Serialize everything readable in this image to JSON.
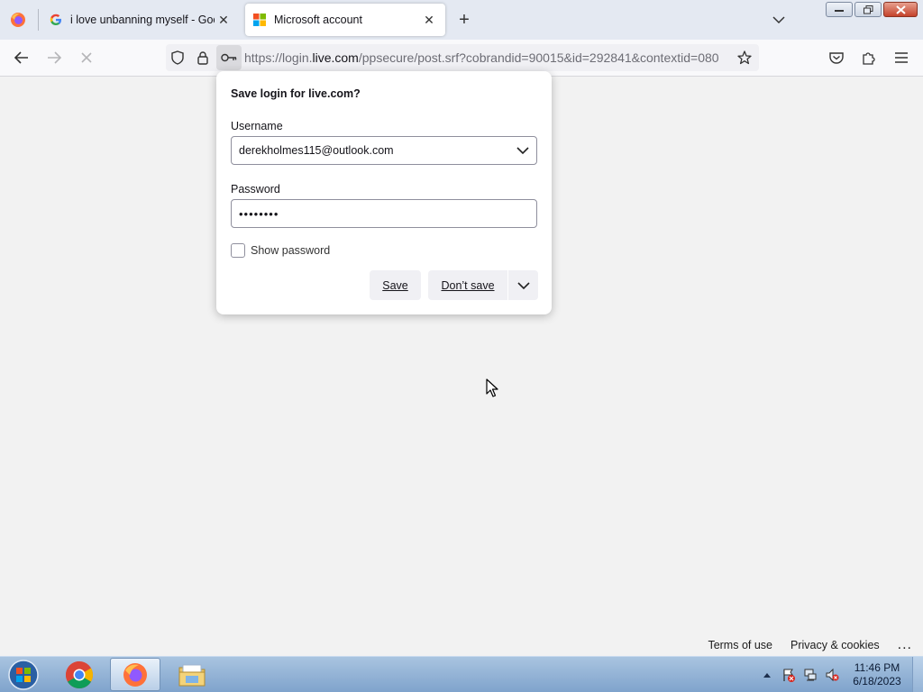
{
  "browser": {
    "tabs": [
      {
        "title": "i love unbanning myself - Goog",
        "favicon": "google-icon",
        "active": false
      },
      {
        "title": "Microsoft account",
        "favicon": "microsoft-icon",
        "active": true
      }
    ],
    "url": {
      "prefix": "https://login.",
      "host": "live.com",
      "path": "/ppsecure/post.srf?cobrandid=90015&id=292841&contextid=080"
    }
  },
  "doorhanger": {
    "title": "Save login for live.com?",
    "username_label": "Username",
    "username_value": "derekholmes115@outlook.com",
    "password_label": "Password",
    "password_value": "••••••••",
    "show_password_label": "Show password",
    "save_label": "Save",
    "dont_save_label": "Don’t save"
  },
  "footer": {
    "terms": "Terms of use",
    "privacy": "Privacy & cookies",
    "more": "..."
  },
  "taskbar": {
    "apps": [
      "chrome-icon",
      "firefox-icon",
      "file-explorer-icon"
    ],
    "clock_time": "11:46 PM",
    "clock_date": "6/18/2023"
  }
}
